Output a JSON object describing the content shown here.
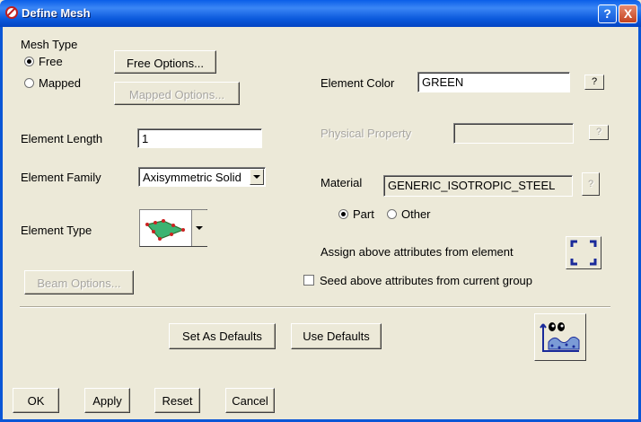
{
  "window": {
    "title": "Define Mesh"
  },
  "titlebar_buttons": {
    "help": "?",
    "close": "X"
  },
  "mesh_type": {
    "label": "Mesh Type",
    "free": "Free",
    "mapped": "Mapped",
    "selected": "Free"
  },
  "buttons": {
    "free_options": "Free Options...",
    "mapped_options": "Mapped Options...",
    "beam_options": "Beam Options...",
    "set_as_defaults": "Set As Defaults",
    "use_defaults": "Use Defaults",
    "ok": "OK",
    "apply": "Apply",
    "reset": "Reset",
    "cancel": "Cancel"
  },
  "element_length": {
    "label": "Element Length",
    "value": "1"
  },
  "element_family": {
    "label": "Element Family",
    "value": "Axisymmetric Solid"
  },
  "element_type": {
    "label": "Element Type",
    "icon": "axisymmetric-element-icon"
  },
  "element_color": {
    "label": "Element Color",
    "value": "GREEN",
    "help": "?"
  },
  "physical_property": {
    "label": "Physical Property",
    "value": "",
    "help": "?"
  },
  "material": {
    "label": "Material",
    "value": "GENERIC_ISOTROPIC_STEEL",
    "help": "?",
    "part": "Part",
    "other": "Other",
    "selected": "Part"
  },
  "assign": {
    "label": "Assign above attributes from element",
    "icon": "select-element-icon"
  },
  "seed": {
    "label": "Seed above attributes from current group",
    "checked": false
  },
  "colors": {
    "title_bar": "#0a5ee8",
    "dialog_bg": "#ece9d8",
    "element_shape": "#3cb371"
  }
}
